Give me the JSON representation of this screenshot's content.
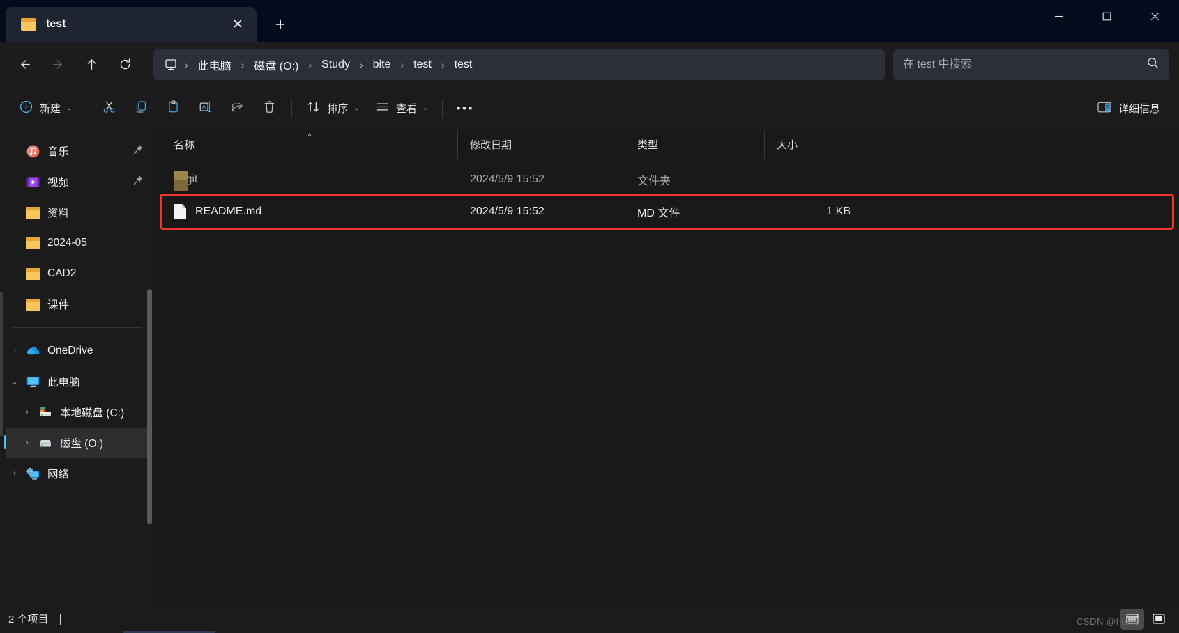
{
  "window": {
    "tab_title": "test",
    "tab_close_label": "✕",
    "new_tab_label": "+",
    "minimize_label": "minimize",
    "maximize_label": "maximize",
    "close_label": "close"
  },
  "nav": {
    "back_label": "←",
    "forward_label": "→",
    "up_label": "↑",
    "refresh_label": "↻",
    "breadcrumbs": [
      {
        "label": "此电脑"
      },
      {
        "label": "磁盘 (O:)"
      },
      {
        "label": "Study"
      },
      {
        "label": "bite"
      },
      {
        "label": "test"
      },
      {
        "label": "test"
      }
    ],
    "separator": "›"
  },
  "search": {
    "placeholder": "在 test 中搜索",
    "value": ""
  },
  "toolbar": {
    "new_label": "新建",
    "cut_label": "剪切",
    "copy_label": "复制",
    "paste_label": "粘贴",
    "rename_label": "重命名",
    "share_label": "共享",
    "delete_label": "删除",
    "sort_label": "排序",
    "view_label": "查看",
    "more_label": "•••",
    "details_label": "详细信息",
    "chevron": "⌄"
  },
  "sidebar": {
    "quick_items": [
      {
        "label": "音乐",
        "icon": "music-icon",
        "pinned": true
      },
      {
        "label": "视频",
        "icon": "video-icon",
        "pinned": true
      },
      {
        "label": "资料",
        "icon": "folder-icon",
        "pinned": false
      },
      {
        "label": "2024-05",
        "icon": "folder-icon",
        "pinned": false
      },
      {
        "label": "CAD2",
        "icon": "folder-icon",
        "pinned": false
      },
      {
        "label": "课件",
        "icon": "folder-icon",
        "pinned": false
      }
    ],
    "tree_items": [
      {
        "label": "OneDrive",
        "icon": "onedrive-icon",
        "expander": "›",
        "indent": 0,
        "selected": false
      },
      {
        "label": "此电脑",
        "icon": "pc-icon",
        "expander": "⌄",
        "indent": 0,
        "selected": false
      },
      {
        "label": "本地磁盘 (C:)",
        "icon": "windows-drive-icon",
        "expander": "›",
        "indent": 1,
        "selected": false
      },
      {
        "label": "磁盘 (O:)",
        "icon": "drive-icon",
        "expander": "›",
        "indent": 1,
        "selected": true
      },
      {
        "label": "网络",
        "icon": "network-icon",
        "expander": "›",
        "indent": 0,
        "selected": false
      }
    ],
    "pin_glyph": "📌"
  },
  "filelist": {
    "columns": {
      "name": "名称",
      "date": "修改日期",
      "type": "类型",
      "size": "大小"
    },
    "sort_indicator": "˄",
    "rows": [
      {
        "name": ".git",
        "date": "2024/5/9 15:52",
        "type": "文件夹",
        "size": "",
        "icon": "folder-icon",
        "hidden": true,
        "highlighted": false
      },
      {
        "name": "README.md",
        "date": "2024/5/9 15:52",
        "type": "MD 文件",
        "size": "1 KB",
        "icon": "file-icon",
        "hidden": false,
        "highlighted": true
      }
    ]
  },
  "statusbar": {
    "item_count": "2 个项目",
    "details_view_label": "详细信息视图",
    "large_icons_view_label": "大图标视图",
    "watermark": "CSDN @honid"
  },
  "colors": {
    "accent": "#4cc2ff",
    "highlight": "#f4352e",
    "titlebar": "#030c1c",
    "folder": "#f6c65c"
  }
}
